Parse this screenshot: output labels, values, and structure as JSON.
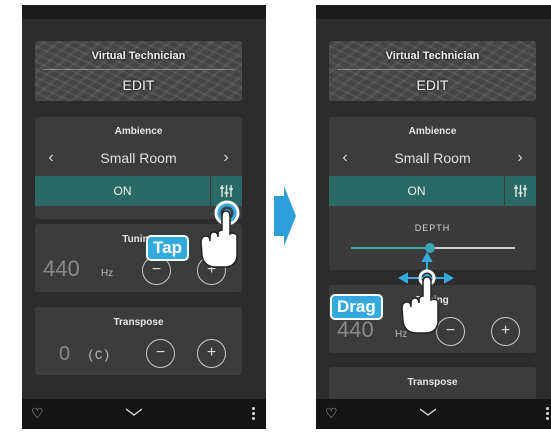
{
  "colors": {
    "accent": "#3aa7b3",
    "toggle_bg": "#2a6965",
    "callout": "#34a9dd",
    "arrow": "#2f9fd9"
  },
  "screens": [
    {
      "virtual_technician": {
        "title": "Virtual Technician",
        "action": "EDIT"
      },
      "ambience": {
        "title": "Ambience",
        "prev": "‹",
        "value": "Small Room",
        "next": "›",
        "toggle": "ON"
      },
      "tuning": {
        "title": "Tuning",
        "value": "440",
        "unit": "Hz",
        "minus": "−",
        "plus": "+"
      },
      "transpose": {
        "title": "Transpose",
        "value": "0",
        "note": "(C)",
        "minus": "−",
        "plus": "+"
      },
      "gesture_label": "Tap"
    },
    {
      "virtual_technician": {
        "title": "Virtual Technician",
        "action": "EDIT"
      },
      "ambience": {
        "title": "Ambience",
        "prev": "‹",
        "value": "Small Room",
        "next": "›",
        "toggle": "ON"
      },
      "depth": {
        "label": "DEPTH",
        "level": 0.48
      },
      "tuning": {
        "title": "Tuning",
        "value": "440",
        "unit": "Hz",
        "minus": "−",
        "plus": "+"
      },
      "transpose": {
        "title": "Transpose",
        "minus": "−",
        "plus": "+"
      },
      "gesture_label": "Drag"
    }
  ],
  "nav_icons": [
    "heart-icon",
    "collapse-chevron-icon",
    "more-vertical-icon"
  ]
}
